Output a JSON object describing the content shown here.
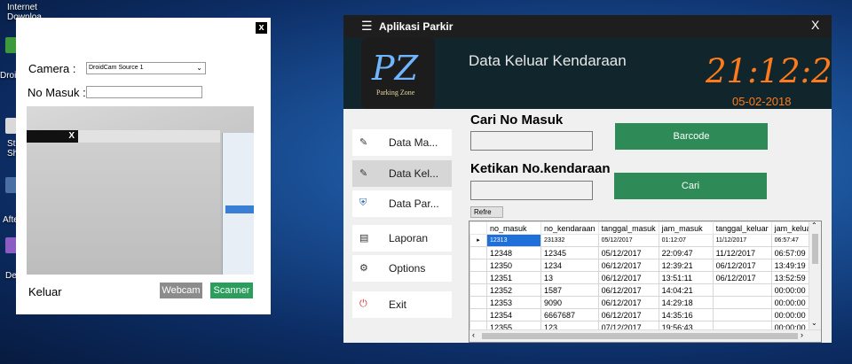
{
  "desktop": {
    "icons": [
      {
        "label": "Internet Downloa"
      },
      {
        "label": "Droi"
      },
      {
        "label": "St Sh"
      },
      {
        "label": "Afte"
      },
      {
        "label": "De"
      }
    ]
  },
  "camera_dialog": {
    "close_glyph": "x",
    "camera_label": "Camera :",
    "camera_selected": "DroidCam Source 1",
    "no_masuk_label": "No Masuk :",
    "no_masuk_value": "",
    "preview_overlay_glyph": "X",
    "keluar_label": "Keluar",
    "webcam_button": "Webcam",
    "scanner_button": "Scanner"
  },
  "app": {
    "title": "Aplikasi Parkir",
    "close_glyph": "X",
    "logo_letters": "PZ",
    "logo_caption": "Parking Zone",
    "page_title": "Data Keluar Kendaraan",
    "clock_time": "21:12:2",
    "clock_date": "05-02-2018",
    "sidebar": [
      {
        "label": "Data Ma..."
      },
      {
        "label": "Data Kel..."
      },
      {
        "label": "Data Par..."
      },
      {
        "label": "Laporan"
      },
      {
        "label": "Options"
      },
      {
        "label": "Exit"
      }
    ],
    "search_no_masuk_label": "Cari No Masuk",
    "barcode_button": "Barcode",
    "ketikan_label": "Ketikan No.kendaraan",
    "cari_button": "Cari",
    "refresh_button": "Refre",
    "table": {
      "columns": [
        "no_masuk",
        "no_kendaraan",
        "tanggal_masuk",
        "jam_masuk",
        "tanggal_keluar",
        "jam_keluar"
      ],
      "rows": [
        [
          "12313",
          "231332",
          "05/12/2017",
          "01:12:07",
          "11/12/2017",
          "06:57:47"
        ],
        [
          "12348",
          "12345",
          "05/12/2017",
          "22:09:47",
          "11/12/2017",
          "06:57:09"
        ],
        [
          "12350",
          "1234",
          "06/12/2017",
          "12:39:21",
          "06/12/2017",
          "13:49:19"
        ],
        [
          "12351",
          "13",
          "06/12/2017",
          "13:51:11",
          "06/12/2017",
          "13:52:59"
        ],
        [
          "12352",
          "1587",
          "06/12/2017",
          "14:04:21",
          "",
          "00:00:00"
        ],
        [
          "12353",
          "9090",
          "06/12/2017",
          "14:29:18",
          "",
          "00:00:00"
        ],
        [
          "12354",
          "6667687",
          "06/12/2017",
          "14:35:16",
          "",
          "00:00:00"
        ],
        [
          "12355",
          "123",
          "07/12/2017",
          "19:56:43",
          "",
          "00:00:00"
        ]
      ]
    },
    "colors": {
      "accent_green": "#2e8b57",
      "clock_orange": "#ff7a1a",
      "header_bg": "#10262c"
    }
  }
}
